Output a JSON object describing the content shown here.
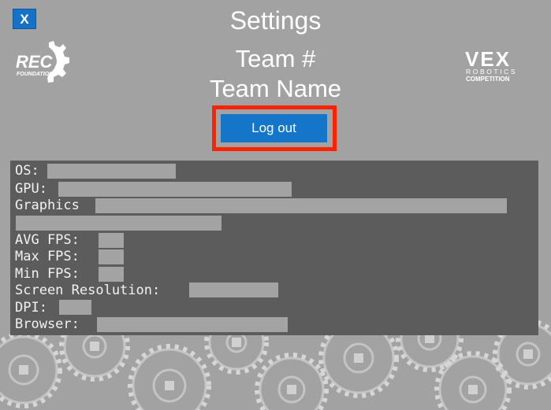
{
  "dialog": {
    "close_label": "X",
    "title": "Settings",
    "team_number_label": "Team #",
    "team_name_label": "Team Name",
    "logout_label": "Log out"
  },
  "logos": {
    "rec_main": "REC",
    "rec_sub": "FOUNDATION",
    "vex_main": "VEX",
    "vex_line1": "ROBOTICS",
    "vex_line2": "COMPETITION"
  },
  "system_info": {
    "os_label": "OS:",
    "gpu_label": "GPU:",
    "graphics_label": "Graphics",
    "avg_fps_label": "AVG FPS:",
    "max_fps_label": "Max FPS:",
    "min_fps_label": "Min FPS:",
    "screen_resolution_label": "Screen Resolution:",
    "dpi_label": "DPI:",
    "browser_label": "Browser:"
  },
  "colors": {
    "background": "#a2a2a2",
    "panel": "#5c5c5c",
    "button": "#1576c9",
    "highlight": "#ff2200",
    "redaction": "#a3a3a3"
  },
  "icons": {
    "close": "close-icon",
    "rec_logo": "rec-foundation-logo",
    "vex_logo": "vex-robotics-competition-logo"
  }
}
